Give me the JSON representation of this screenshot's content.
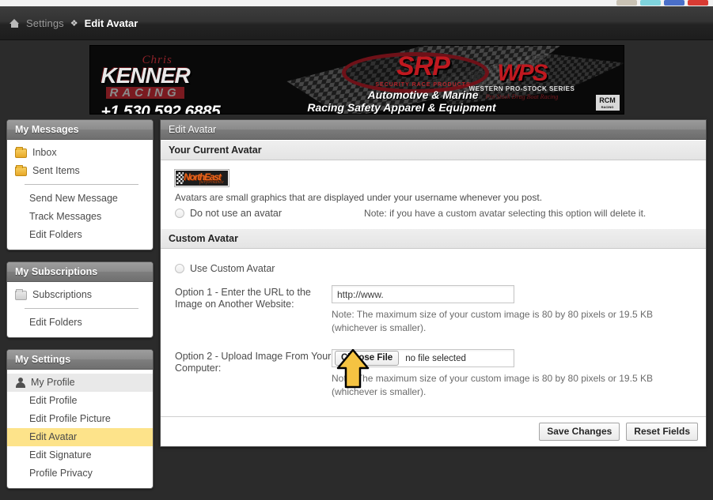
{
  "browser": {
    "chips": [
      "#c9c2b4",
      "#7fd4dd",
      "#4a6fc9",
      "#d93b33"
    ]
  },
  "breadcrumb": {
    "home_icon": "home-icon",
    "parent": "Settings",
    "separator": "❖",
    "current": "Edit Avatar"
  },
  "banner": {
    "kenner": {
      "script": "Chris",
      "main": "KENNER",
      "sub": "RACING",
      "phone": "+1 530 592 6885"
    },
    "srp": {
      "text": "SRP",
      "subtitle": "SECURITY RACE PRODUCTS",
      "line1": "Automotive & Marine",
      "line2": "Racing Safety Apparel & Equipment"
    },
    "wps": {
      "text": "WPS",
      "subtitle": "WESTERN PRO-STOCK SERIES",
      "tagline": "Pro Stock Drag Boat Racing"
    },
    "corner_badge": "RCM",
    "corner_badge_sub": "RACING"
  },
  "sidebar": {
    "panels": [
      {
        "title": "My Messages",
        "items": [
          {
            "label": "Inbox",
            "icon": "folder-icon",
            "active": false
          },
          {
            "label": "Sent Items",
            "icon": "folder-icon",
            "active": false
          }
        ],
        "sub_items": [
          {
            "label": "Send New Message",
            "active": false
          },
          {
            "label": "Track Messages",
            "active": false
          },
          {
            "label": "Edit Folders",
            "active": false
          }
        ]
      },
      {
        "title": "My Subscriptions",
        "items": [
          {
            "label": "Subscriptions",
            "icon": "folder-icon-gray",
            "active": false
          }
        ],
        "sub_items": [
          {
            "label": "Edit Folders",
            "active": false
          }
        ]
      },
      {
        "title": "My Settings",
        "items": [
          {
            "label": "My Profile",
            "icon": "person-icon",
            "active": false
          }
        ],
        "sub_items": [
          {
            "label": "Edit Profile",
            "active": false
          },
          {
            "label": "Edit Profile Picture",
            "active": false
          },
          {
            "label": "Edit Avatar",
            "active": true
          },
          {
            "label": "Edit Signature",
            "active": false
          },
          {
            "label": "Profile Privacy",
            "active": false
          }
        ]
      }
    ],
    "highlight_color": "#fde38a"
  },
  "content": {
    "title": "Edit Avatar",
    "current_avatar": {
      "section_title": "Your Current Avatar",
      "avatar_text": "NorthEast",
      "avatar_subtext": "performance",
      "description": "Avatars are small graphics that are displayed under your username whenever you post.",
      "no_avatar_label": "Do not use an avatar",
      "no_avatar_note": "Note: if you have a custom avatar selecting this option will delete it."
    },
    "custom_avatar": {
      "section_title": "Custom Avatar",
      "use_custom_label": "Use Custom Avatar",
      "option1_label": "Option 1 - Enter the URL to the Image on Another Website:",
      "option1_value": "http://www.",
      "option1_note": "Note: The maximum size of your custom image is 80 by 80 pixels or 19.5 KB (whichever is smaller).",
      "option2_label": "Option 2 - Upload Image From Your Computer:",
      "choose_file_label": "Choose File",
      "file_status": "no file selected",
      "option2_note": "Note: The maximum size of your custom image is 80 by 80 pixels or 19.5 KB (whichever is smaller)."
    },
    "footer": {
      "save_label": "Save Changes",
      "reset_label": "Reset Fields"
    }
  },
  "cursor": {
    "type": "arrow-cursor-up",
    "fill": "#f5c342",
    "stroke": "#000000"
  }
}
